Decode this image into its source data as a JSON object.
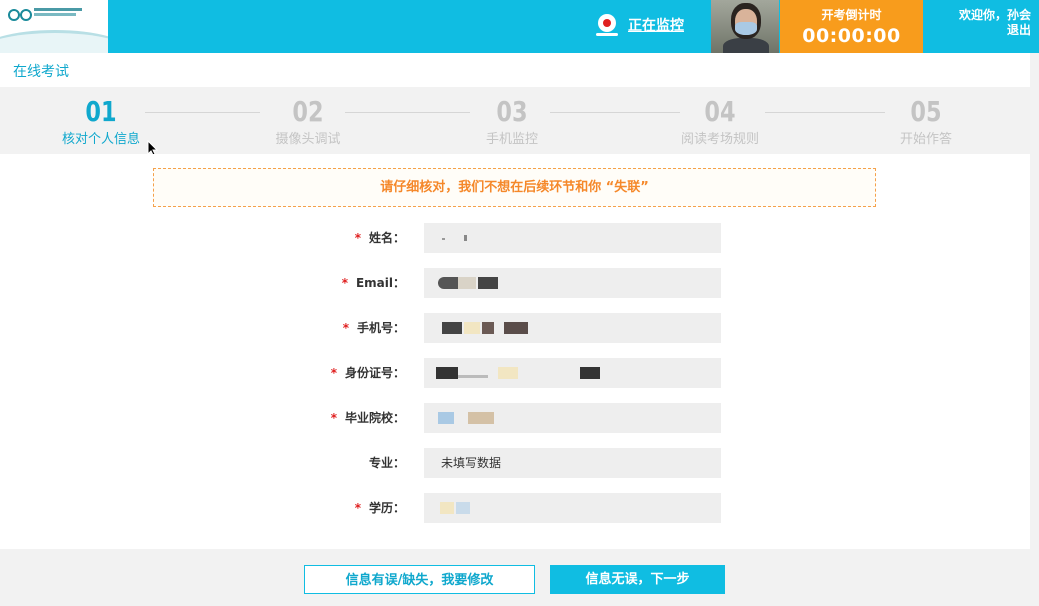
{
  "header": {
    "monitor_label": "正在监控",
    "countdown_label": "开考倒计时",
    "countdown_time": "00:00:00",
    "welcome": "欢迎你，孙会",
    "logout": "退出",
    "accent_color": "#10bde2",
    "countdown_color": "#f89c1c"
  },
  "subheader": {
    "title": "在线考试"
  },
  "steps": [
    {
      "number": "01",
      "label": "核对个人信息",
      "active": true
    },
    {
      "number": "02",
      "label": "摄像头调试",
      "active": false
    },
    {
      "number": "03",
      "label": "手机监控",
      "active": false
    },
    {
      "number": "04",
      "label": "阅读考场规则",
      "active": false
    },
    {
      "number": "05",
      "label": "开始作答",
      "active": false
    }
  ],
  "notice": "请仔细核对，我们不想在后续环节和你 “失联”",
  "form": {
    "fields": [
      {
        "label": "姓名：",
        "required": true,
        "value": ""
      },
      {
        "label": "Email：",
        "required": true,
        "value": ""
      },
      {
        "label": "手机号：",
        "required": true,
        "value": ""
      },
      {
        "label": "身份证号：",
        "required": true,
        "value": ""
      },
      {
        "label": "毕业院校：",
        "required": true,
        "value": ""
      },
      {
        "label": "专业：",
        "required": false,
        "value": "未填写数据"
      },
      {
        "label": "学历：",
        "required": true,
        "value": ""
      }
    ]
  },
  "buttons": {
    "edit": "信息有误/缺失，我要修改",
    "next": "信息无误，下一步"
  },
  "required_mark": "*"
}
